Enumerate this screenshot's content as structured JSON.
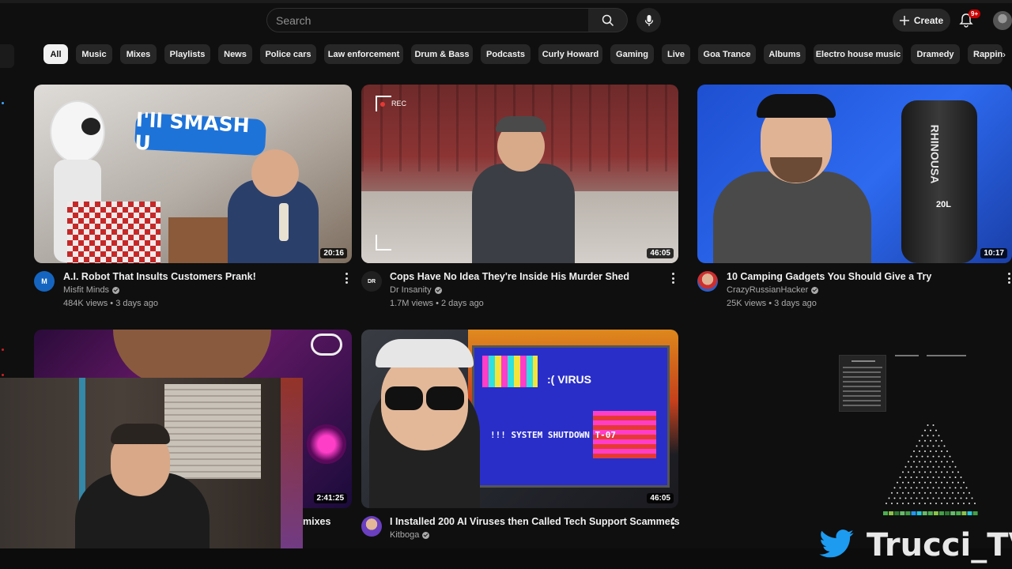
{
  "search": {
    "placeholder": "Search"
  },
  "header": {
    "create_label": "Create",
    "notifications_badge": "9+"
  },
  "chips": [
    {
      "label": "All",
      "active": true
    },
    {
      "label": "Music"
    },
    {
      "label": "Mixes"
    },
    {
      "label": "Playlists"
    },
    {
      "label": "News"
    },
    {
      "label": "Police cars"
    },
    {
      "label": "Law enforcement"
    },
    {
      "label": "Drum & Bass"
    },
    {
      "label": "Podcasts"
    },
    {
      "label": "Curly Howard"
    },
    {
      "label": "Gaming"
    },
    {
      "label": "Live"
    },
    {
      "label": "Goa Trance"
    },
    {
      "label": "Albums"
    },
    {
      "label": "Electro house music"
    },
    {
      "label": "Dramedy"
    },
    {
      "label": "Rapping"
    }
  ],
  "videos": [
    {
      "title": "A.I. Robot That Insults Customers Prank!",
      "channel": "Misfit Minds",
      "meta": "484K views • 3 days ago",
      "duration": "20:16",
      "thumb_text": "I'll SMASH U"
    },
    {
      "title": "Cops Have No Idea They're Inside His Murder Shed",
      "channel": "Dr Insanity",
      "meta": "1.7M views • 2 days ago",
      "duration": "46:05",
      "thumb_text": "REC"
    },
    {
      "title": "10 Camping Gadgets You Should Give a Try",
      "channel": "CrazyRussianHacker",
      "meta": "25K views • 3 days ago",
      "duration": "10:17",
      "thumb_text": "RHINOUSA",
      "thumb_text_2": "20L"
    },
    {
      "title": "mixes",
      "duration": "2:41:25"
    },
    {
      "title": "I Installed 200 AI Viruses then Called Tech Support Scammers",
      "channel": "Kitboga",
      "duration": "46:05",
      "thumb_text": ":( VIRUS",
      "thumb_text_2": "!!! SYSTEM SHUTDOWN T-07"
    }
  ],
  "overlay": {
    "handle": "Trucci_TV"
  },
  "colors": {
    "background": "#0f0f0f",
    "chip": "#272727",
    "chip_active": "#f1f1f1",
    "badge": "#cc0000",
    "twitter": "#1d9bf0"
  }
}
